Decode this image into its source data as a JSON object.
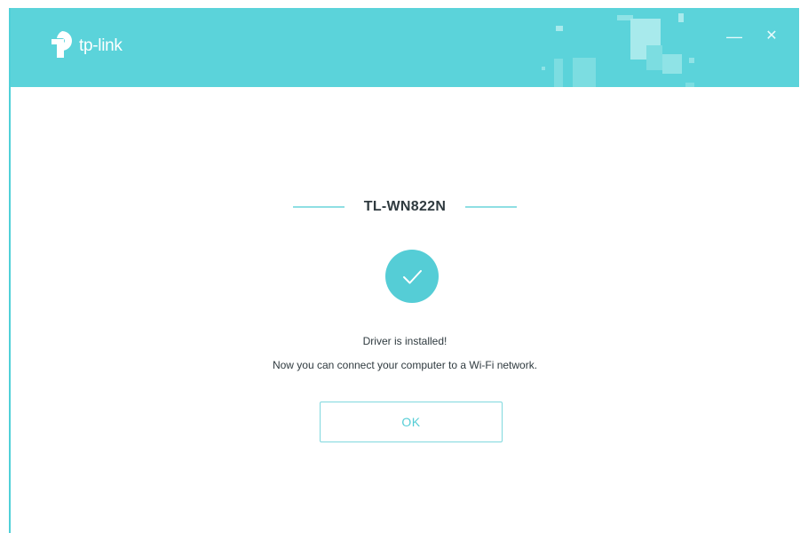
{
  "app": {
    "brand": "tp-link",
    "logo_icon": "tp-link-logo-icon"
  },
  "window_controls": {
    "minimize_label": "—",
    "close_label": "✕"
  },
  "main": {
    "device_name": "TL-WN822N",
    "status_icon": "check-icon",
    "message_line1": "Driver is installed!",
    "message_line2": "Now you can connect your computer to a Wi-Fi network.",
    "ok_label": "OK"
  },
  "colors": {
    "accent": "#5bd3da",
    "text": "#2f3a3f",
    "button_text": "#55cdd6"
  }
}
